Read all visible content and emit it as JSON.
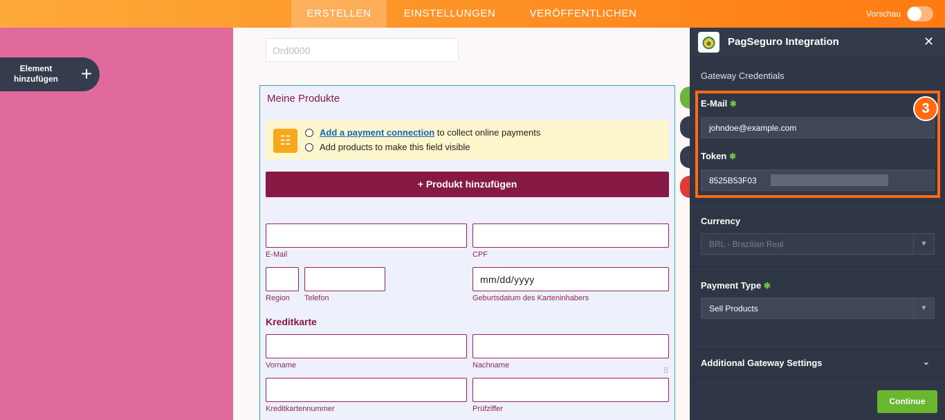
{
  "header": {
    "tabs": [
      {
        "label": "ERSTELLEN",
        "active": true
      },
      {
        "label": "EINSTELLUNGEN",
        "active": false
      },
      {
        "label": "VERÖFFENTLICHEN",
        "active": false
      }
    ],
    "preview_label": "Vorschau",
    "preview_on": false
  },
  "sidebar": {
    "add_element_label": "Element hinzufügen",
    "add_icon": "plus-icon"
  },
  "form": {
    "order_placeholder": "Ord0000",
    "products": {
      "title": "Meine Produkte",
      "notice_link": "Add a payment connection",
      "notice_line1_rest": " to collect online payments",
      "notice_line2": "Add products to make this field visible",
      "add_button": "+ Produkt hinzufügen"
    },
    "fields": {
      "email": "E-Mail",
      "cpf": "CPF",
      "region": "Region",
      "phone": "Telefon",
      "birthdate": "Geburtsdatum des Karteninhabers",
      "birthdate_placeholder": "mm/dd/yyyy",
      "first_name": "Vorname",
      "last_name": "Nachname",
      "card_number": "Kreditkartennummer",
      "check_digit": "Prüfziffer"
    },
    "credit_card_title": "Kreditkarte"
  },
  "panel": {
    "title": "PagSeguro Integration",
    "section_label": "Gateway Credentials",
    "email_label": "E-Mail",
    "email_value": "johndoe@example.com",
    "token_label": "Token",
    "token_value": "8525B53F03",
    "step_number": "3",
    "currency_label": "Currency",
    "currency_value": "BRL - Brazilian Real",
    "payment_type_label": "Payment Type",
    "payment_type_value": "Sell Products",
    "additional_settings": "Additional Gateway Settings",
    "continue": "Continue"
  },
  "colors": {
    "accent_orange": "#ff6a13",
    "brand_maroon": "#871a44",
    "continue_green": "#68b72f"
  }
}
